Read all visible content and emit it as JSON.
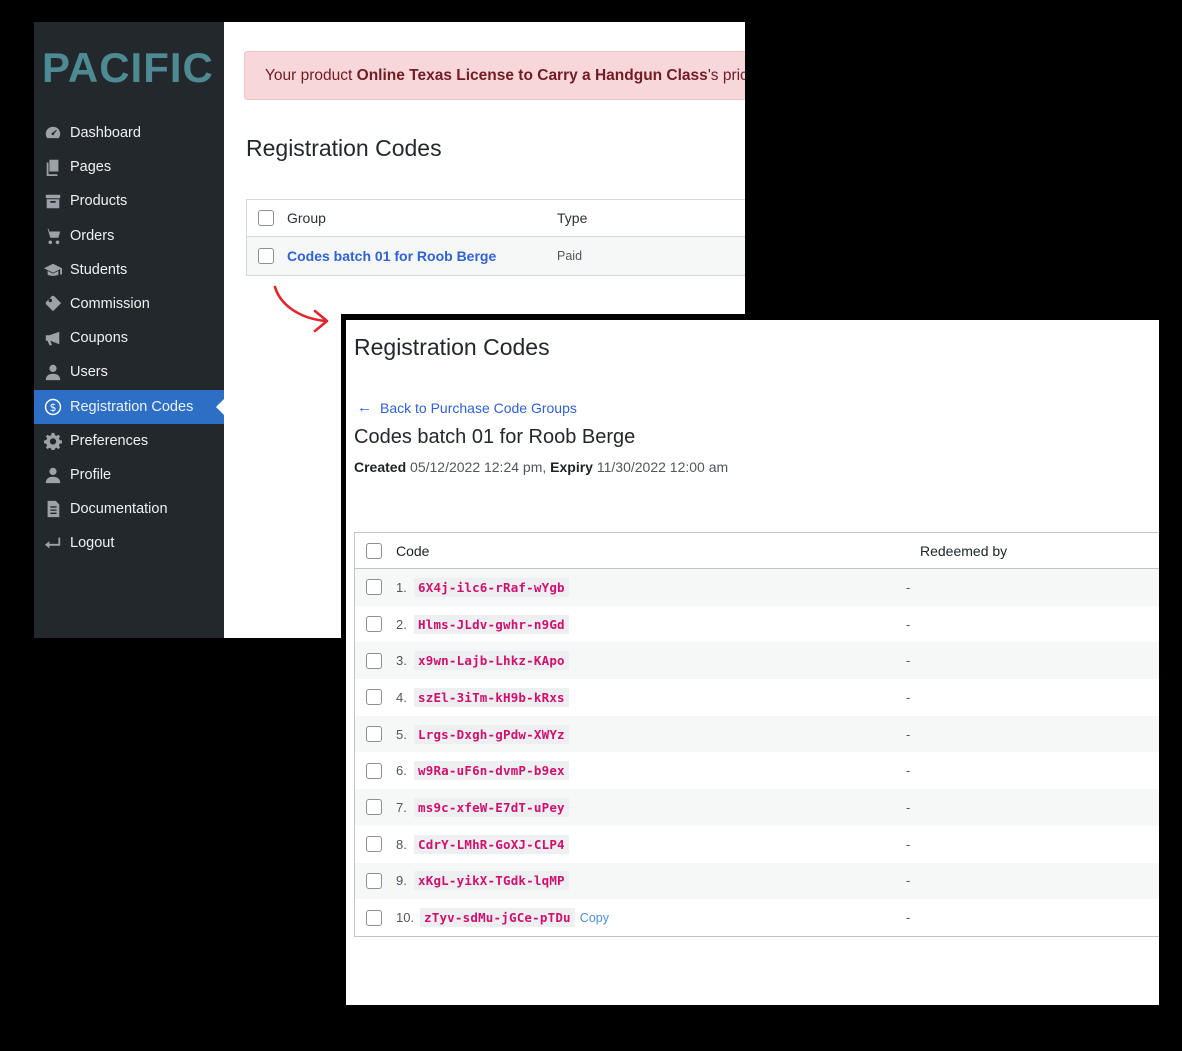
{
  "sidebar": {
    "logo": "PACIFIC",
    "items": [
      {
        "label": "Dashboard",
        "icon": "dashboard-icon"
      },
      {
        "label": "Pages",
        "icon": "pages-icon"
      },
      {
        "label": "Products",
        "icon": "archive-icon"
      },
      {
        "label": "Orders",
        "icon": "cart-icon"
      },
      {
        "label": "Students",
        "icon": "graduation-cap-icon"
      },
      {
        "label": "Commission",
        "icon": "tag-icon"
      },
      {
        "label": "Coupons",
        "icon": "megaphone-icon"
      },
      {
        "label": "Users",
        "icon": "user-icon"
      },
      {
        "label": "Registration Codes",
        "icon": "dollar-icon",
        "active": true
      },
      {
        "label": "Preferences",
        "icon": "gear-icon"
      },
      {
        "label": "Profile",
        "icon": "user-icon"
      },
      {
        "label": "Documentation",
        "icon": "document-icon"
      },
      {
        "label": "Logout",
        "icon": "return-icon"
      }
    ]
  },
  "notice": {
    "prefix": "Your product ",
    "product": "Online Texas License to Carry a Handgun Class",
    "suffix": "'s price"
  },
  "back_page": {
    "title": "Registration Codes",
    "table": {
      "headers": {
        "group": "Group",
        "type": "Type"
      },
      "rows": [
        {
          "group": "Codes batch 01 for Roob Berge",
          "type": "Paid"
        }
      ]
    }
  },
  "front_page": {
    "title": "Registration Codes",
    "back_link": "Back to Purchase Code Groups",
    "batch_title": "Codes batch 01 for Roob Berge",
    "meta": {
      "created_label": "Created",
      "created_value": "05/12/2022 12:24 pm,",
      "expiry_label": "Expiry",
      "expiry_value": "11/30/2022 12:00 am"
    },
    "table": {
      "headers": {
        "code": "Code",
        "redeemed": "Redeemed by"
      },
      "copy_label": "Copy",
      "rows": [
        {
          "num": "1.",
          "code": "6X4j-ilc6-rRaf-wYgb",
          "redeemed": "-"
        },
        {
          "num": "2.",
          "code": "Hlms-JLdv-gwhr-n9Gd",
          "redeemed": "-"
        },
        {
          "num": "3.",
          "code": "x9wn-Lajb-Lhkz-KApo",
          "redeemed": "-"
        },
        {
          "num": "4.",
          "code": "szEl-3iTm-kH9b-kRxs",
          "redeemed": "-"
        },
        {
          "num": "5.",
          "code": "Lrgs-Dxgh-gPdw-XWYz",
          "redeemed": "-"
        },
        {
          "num": "6.",
          "code": "w9Ra-uF6n-dvmP-b9ex",
          "redeemed": "-"
        },
        {
          "num": "7.",
          "code": "ms9c-xfeW-E7dT-uPey",
          "redeemed": "-"
        },
        {
          "num": "8.",
          "code": "CdrY-LMhR-GoXJ-CLP4",
          "redeemed": "-"
        },
        {
          "num": "9.",
          "code": "xKgL-yikX-TGdk-lqMP",
          "redeemed": "-"
        },
        {
          "num": "10.",
          "code": "zTyv-sdMu-jGCe-pTDu",
          "redeemed": "-"
        }
      ]
    }
  },
  "colors": {
    "sidebar": "#23282d",
    "active": "#2c6fc5",
    "link": "#2f62d6",
    "code": "#d0106f",
    "arrow": "#e0262b"
  }
}
